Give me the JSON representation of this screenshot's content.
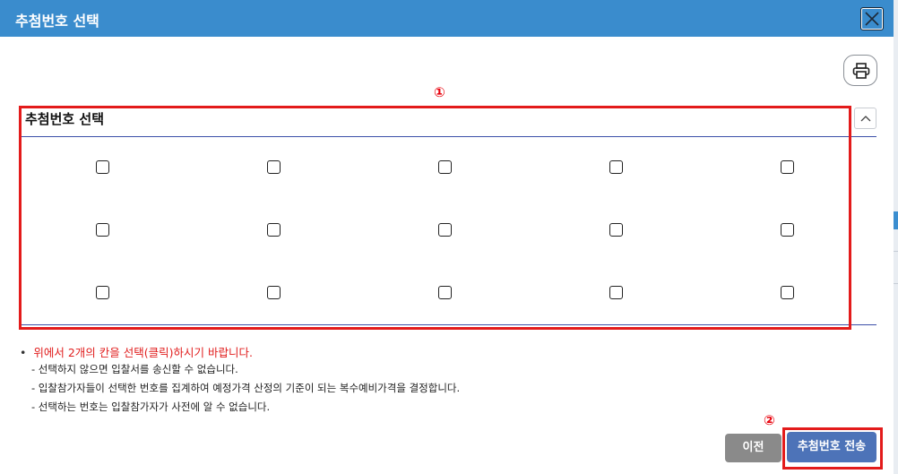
{
  "dialog": {
    "title": "추첨번호 선택",
    "close_icon": "close-icon",
    "print_icon": "printer-icon"
  },
  "markers": {
    "m1": "①",
    "m2": "②"
  },
  "section": {
    "title": "추첨번호 선택",
    "collapse_icon": "chevron-up-icon"
  },
  "checkbox_grid": {
    "rows": 3,
    "cols": 5,
    "checked": [
      false,
      false,
      false,
      false,
      false,
      false,
      false,
      false,
      false,
      false,
      false,
      false,
      false,
      false,
      false
    ]
  },
  "notes": {
    "main": "위에서 2개의 칸을 선택(클릭)하시기 바랍니다.",
    "sub1": "-  선택하지 않으면 입찰서를 송신할 수 없습니다.",
    "sub2": "-  입찰참가자들이 선택한 번호를 집계하여 예정가격 산정의 기준이 되는 복수예비가격을 결정합니다.",
    "sub3": "-  선택하는 번호는 입찰참가자가 사전에 알 수 없습니다."
  },
  "buttons": {
    "prev": "이전",
    "send": "추첨번호 전송"
  },
  "colors": {
    "titlebar": "#3a8ccd",
    "highlight": "#e31b1b",
    "send_button": "#4d73b8",
    "prev_button": "#8a8a8a",
    "note_red": "#e11e1e"
  }
}
